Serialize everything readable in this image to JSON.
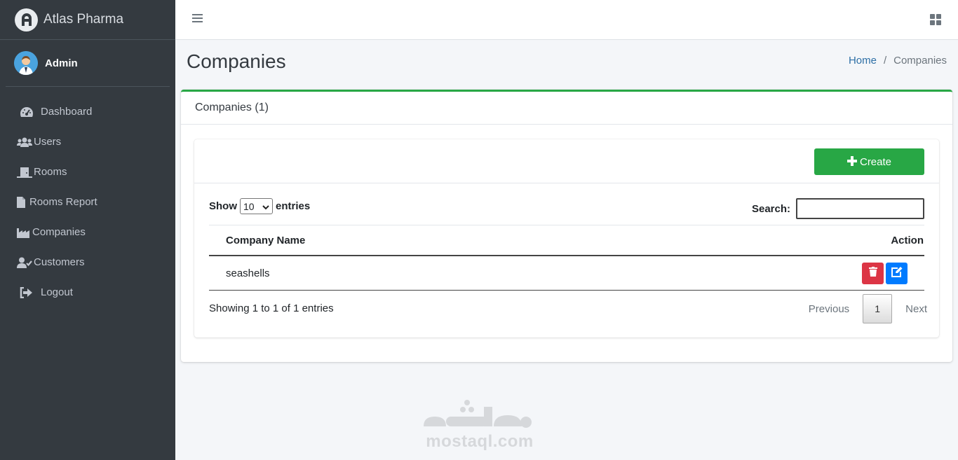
{
  "brand": {
    "name": "Atlas Pharma"
  },
  "user": {
    "name": "Admin"
  },
  "sidebar": {
    "items": [
      {
        "label": "Dashboard",
        "icon": "tachometer-icon"
      },
      {
        "label": "Users",
        "icon": "users-icon"
      },
      {
        "label": "Rooms",
        "icon": "door-icon"
      },
      {
        "label": "Rooms Report",
        "icon": "file-icon"
      },
      {
        "label": "Companies",
        "icon": "industry-icon"
      },
      {
        "label": "Customers",
        "icon": "user-check-icon"
      },
      {
        "label": "Logout",
        "icon": "sign-out-icon"
      }
    ]
  },
  "header": {
    "menu_icon": "hamburger-icon",
    "apps_icon": "grid-icon"
  },
  "page": {
    "title": "Companies"
  },
  "breadcrumb": {
    "home": "Home",
    "separator": "/",
    "current": "Companies"
  },
  "card": {
    "title": "Companies (1)"
  },
  "toolbar": {
    "create_label": "Create",
    "create_icon": "plus-icon"
  },
  "table_controls": {
    "show_label": "Show",
    "page_length": "10",
    "entries_label": "entries",
    "search_label": "Search:",
    "search_value": ""
  },
  "table": {
    "columns": [
      "Company Name",
      "Action"
    ],
    "rows": [
      {
        "company_name": "seashells"
      }
    ]
  },
  "footer": {
    "info": "Showing 1 to 1 of 1 entries",
    "previous": "Previous",
    "current_page": "1",
    "next": "Next"
  },
  "watermark": {
    "text": "mostaql.com"
  },
  "colors": {
    "sidebar_bg": "#343a40",
    "primary_green": "#28a745",
    "danger_red": "#dc3545",
    "primary_blue": "#007bff",
    "link_blue": "#2d6fa6"
  }
}
